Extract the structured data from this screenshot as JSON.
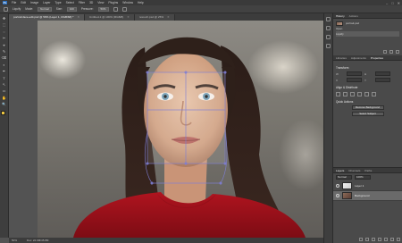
{
  "app": {
    "menu": [
      "File",
      "Edit",
      "Image",
      "Layer",
      "Type",
      "Select",
      "Filter",
      "3D",
      "View",
      "Plugins",
      "Window",
      "Help"
    ],
    "window_controls": [
      "–",
      "□",
      "✕"
    ]
  },
  "options_bar": {
    "tool_label": "Liquify",
    "fields": [
      "Mode:",
      "Normal",
      "Size:",
      "100",
      "Pressure:",
      "50%"
    ]
  },
  "tabs": [
    {
      "label": "portrait-face-edit.psd @ 50% (Layer 1, RGB/8#) *",
      "active": true
    },
    {
      "label": "Untitled-1 @ 100% (RGB/8)",
      "active": false
    },
    {
      "label": "retouch.psd @ 25%",
      "active": false
    }
  ],
  "tools": [
    "✥",
    "⬚",
    "◌",
    "✂",
    "⌖",
    "✎",
    "⌫",
    "◐",
    "✒",
    "T",
    "↖",
    "▭",
    "✋",
    "🔍"
  ],
  "status": {
    "zoom": "50%",
    "doc": "Doc: 22.9M/45.8M"
  },
  "panels": {
    "history_tabs": [
      "History",
      "Actions"
    ],
    "history_items": [
      {
        "label": "portrait.psd"
      },
      {
        "label": "Open"
      },
      {
        "label": "Liquify"
      }
    ],
    "props_tabs": [
      "Libraries",
      "Adjustments",
      "Properties"
    ],
    "props_sections": {
      "transform": "Transform",
      "align": "Align & Distribute",
      "quick": "Quick Actions"
    },
    "props_fields": {
      "w_label": "W",
      "h_label": "H",
      "w": "",
      "h": "",
      "x_label": "X",
      "y_label": "Y",
      "x": "",
      "y": ""
    },
    "buttons": [
      "Remove Background",
      "Select Subject"
    ],
    "layers_tabs": [
      "Layers",
      "Channels",
      "Paths"
    ],
    "blend_mode": "Normal",
    "opacity": "100%",
    "layers": [
      {
        "name": "Layer 1",
        "selected": false
      },
      {
        "name": "Background",
        "selected": true
      }
    ]
  }
}
